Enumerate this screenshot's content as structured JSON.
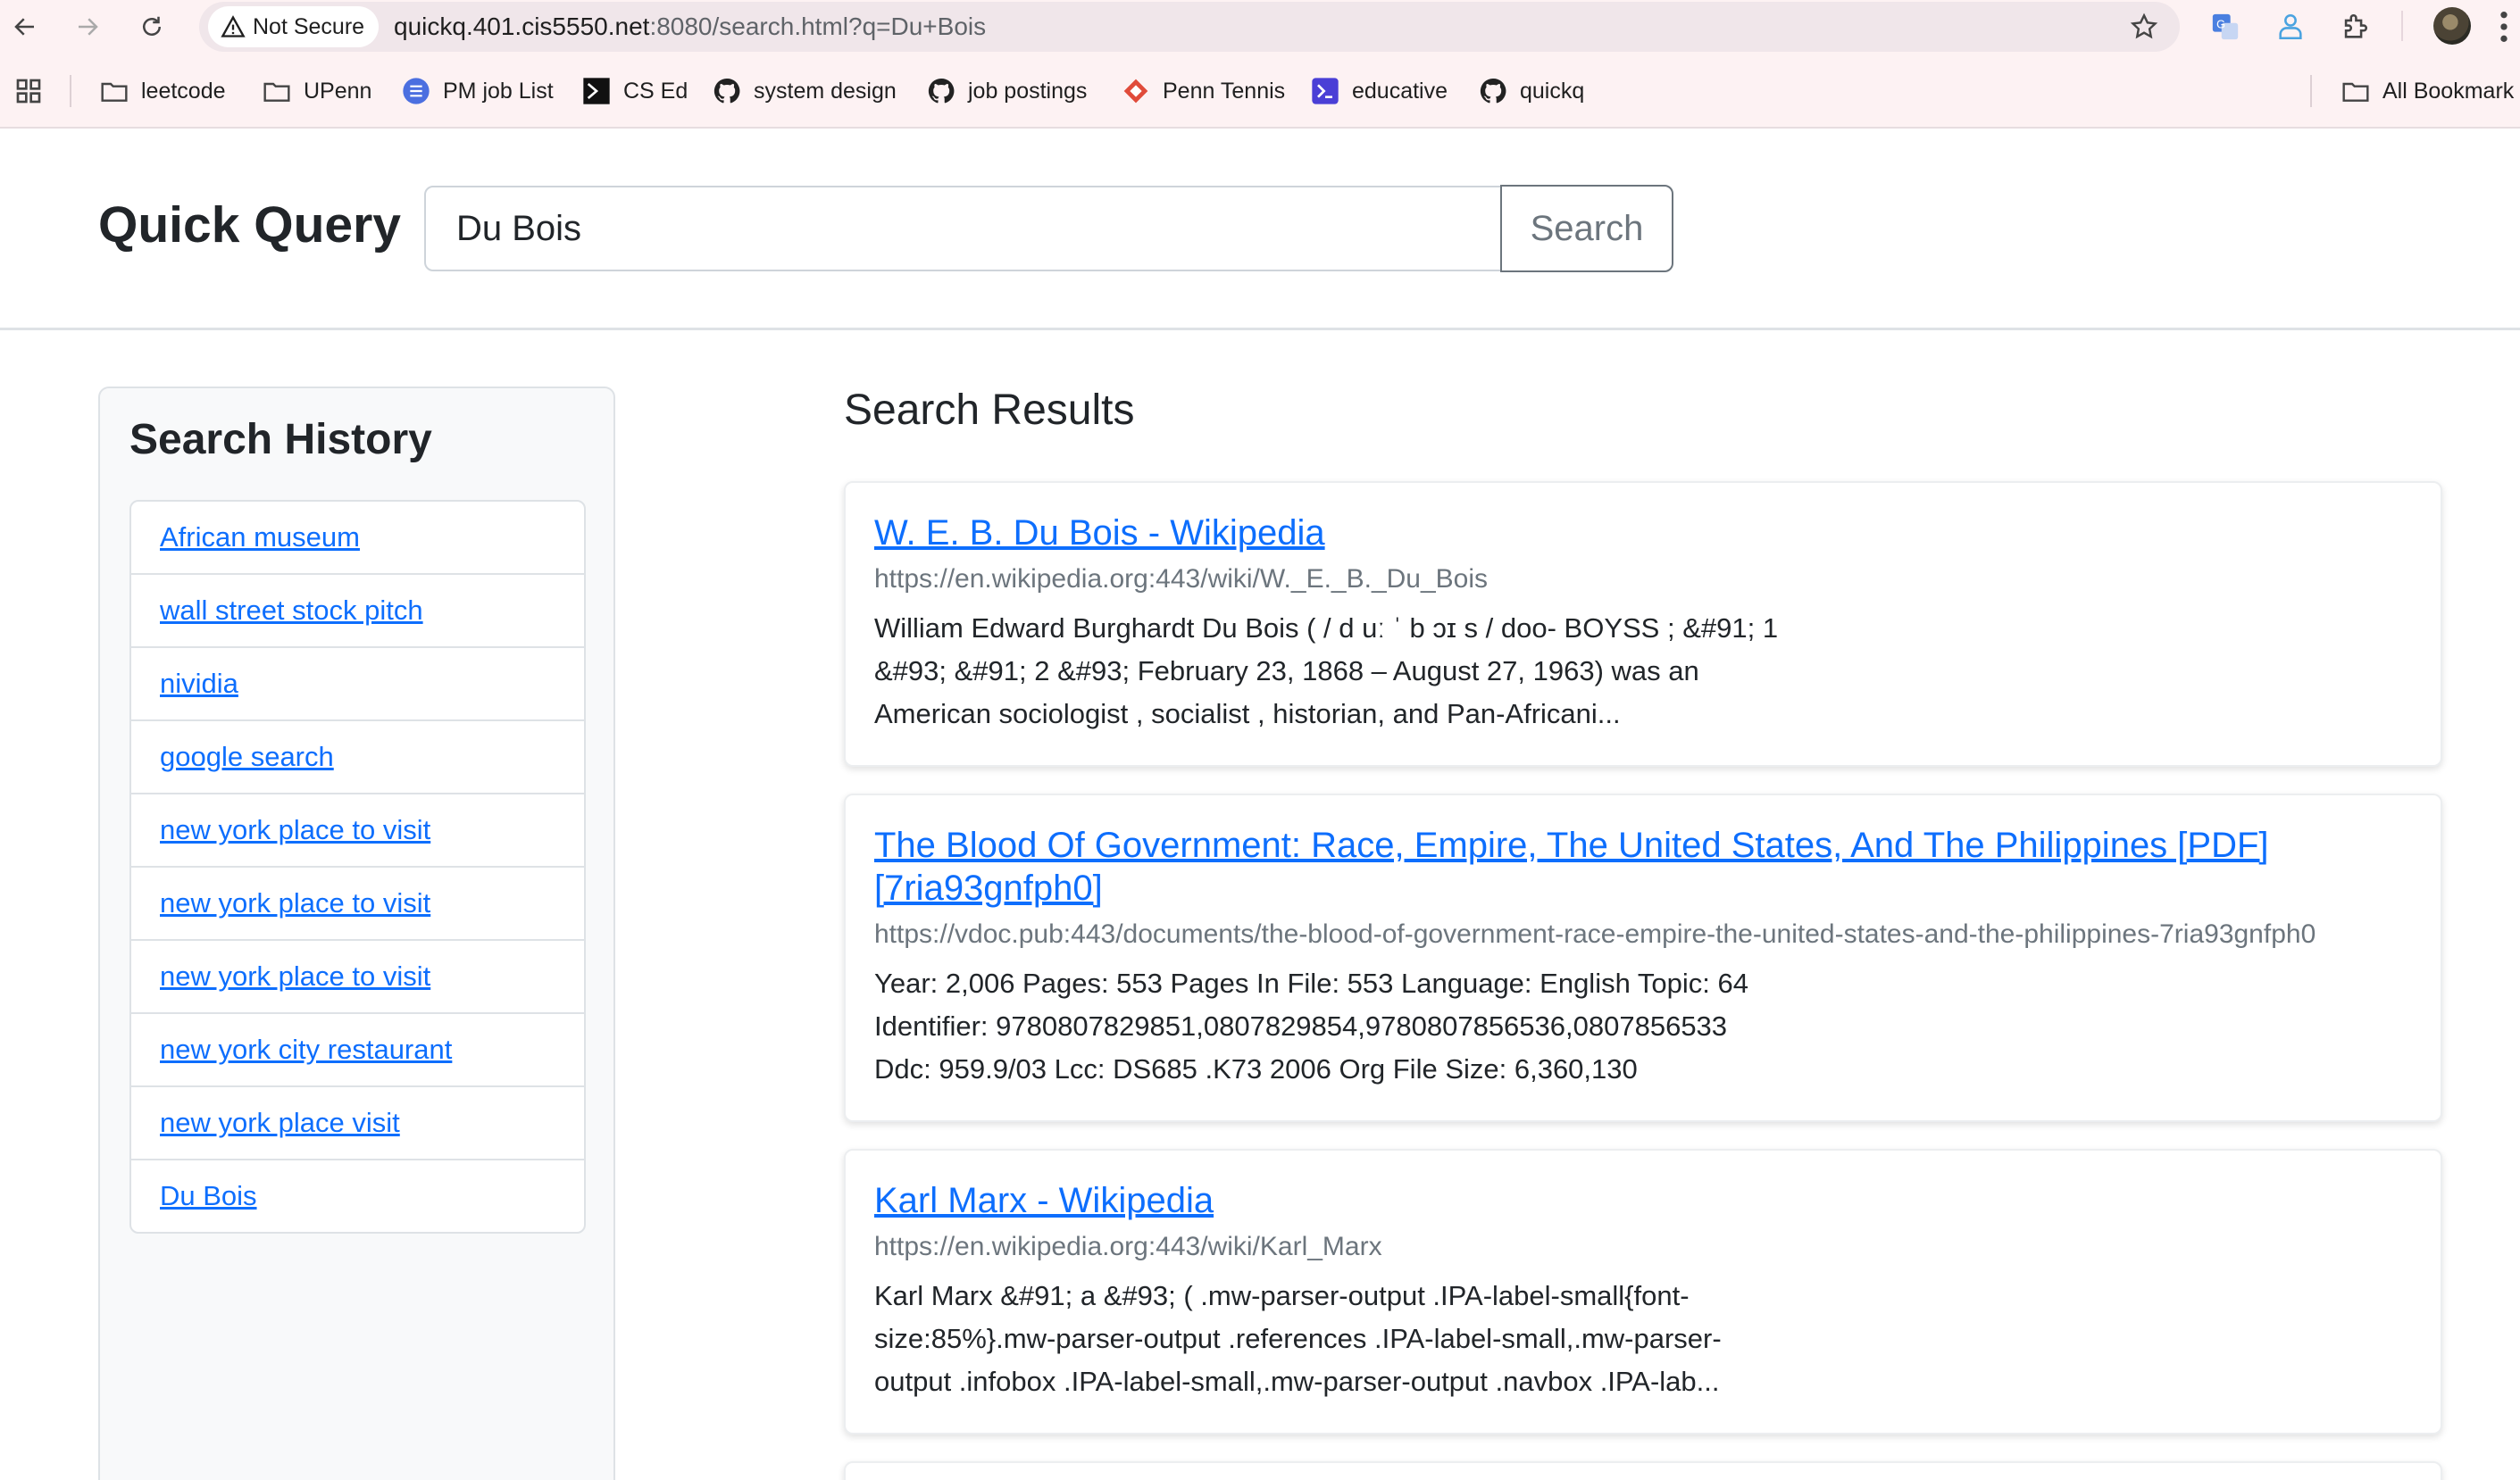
{
  "browser": {
    "security_label": "Not Secure",
    "url_host": "quickq.401.cis5550.net",
    "url_rest": ":8080/search.html?q=Du+Bois",
    "bookmarks": [
      {
        "label": "leetcode",
        "icon": "folder-icon"
      },
      {
        "label": "UPenn",
        "icon": "folder-icon"
      },
      {
        "label": "PM job List",
        "icon": "list-icon"
      },
      {
        "label": "CS Ed",
        "icon": "terminal-icon"
      },
      {
        "label": "system design",
        "icon": "github-icon"
      },
      {
        "label": "job postings",
        "icon": "github-icon"
      },
      {
        "label": "Penn Tennis",
        "icon": "diamond-icon"
      },
      {
        "label": "educative",
        "icon": "educative-icon"
      },
      {
        "label": "quickq",
        "icon": "github-icon"
      }
    ],
    "all_bookmarks_label": "All Bookmark"
  },
  "header": {
    "brand": "Quick Query",
    "search_value": "Du Bois",
    "search_button": "Search"
  },
  "history": {
    "title": "Search History",
    "items": [
      "African museum",
      "wall street stock pitch",
      "nividia",
      "google search",
      "new york place to visit",
      "new york place to visit",
      "new york place to visit",
      "new york city restaurant",
      "new york place visit",
      "Du Bois"
    ]
  },
  "results": {
    "title": "Search Results",
    "items": [
      {
        "title": "W. E. B. Du Bois - Wikipedia",
        "url": "https://en.wikipedia.org:443/wiki/W._E._B._Du_Bois",
        "snippet": "William Edward Burghardt Du Bois ( / d uː ˈ b ɔɪ s / doo- BOYSS ; &#91; 1 &#93; &#91; 2 &#93; February 23, 1868 – August 27, 1963) was an American sociologist , socialist , historian, and Pan-Africani..."
      },
      {
        "title": "The Blood Of Government: Race, Empire, The United States, And The Philippines [PDF] [7ria93gnfph0]",
        "url": "https://vdoc.pub:443/documents/the-blood-of-government-race-empire-the-united-states-and-the-philippines-7ria93gnfph0",
        "snippet": "Year: 2,006 Pages: 553 Pages In File: 553 Language: English Topic: 64 Identifier: 9780807829851,0807829854,9780807856536,0807856533 Ddc: 959.9/03 Lcc: DS685 .K73 2006 Org File Size: 6,360,130"
      },
      {
        "title": "Karl Marx - Wikipedia",
        "url": "https://en.wikipedia.org:443/wiki/Karl_Marx",
        "snippet": "Karl Marx &#91; a &#93; ( .mw-parser-output .IPA-label-small{font-size:85%}.mw-parser-output .references .IPA-label-small,.mw-parser-output .infobox .IPA-label-small,.mw-parser-output .navbox .IPA-lab..."
      }
    ]
  }
}
